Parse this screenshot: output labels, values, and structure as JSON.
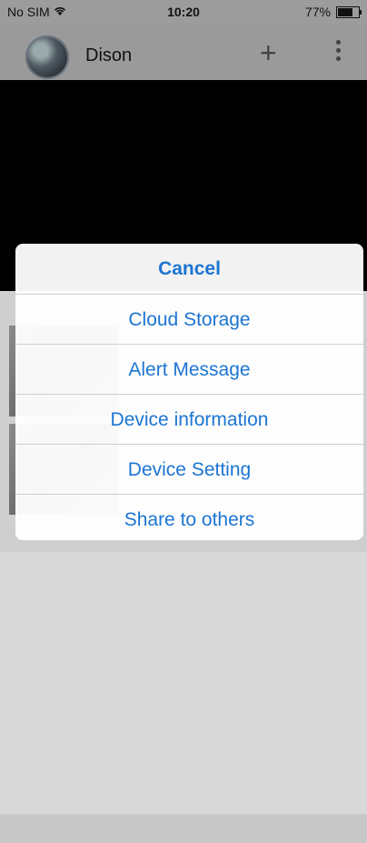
{
  "status_bar": {
    "carrier": "No SIM",
    "time": "10:20",
    "battery_percent": "77%"
  },
  "header": {
    "user_name": "Dison"
  },
  "action_sheet": {
    "items": [
      {
        "label": "Cancel"
      },
      {
        "label": "Cloud Storage"
      },
      {
        "label": "Alert Message"
      },
      {
        "label": "Device information"
      },
      {
        "label": "Device Setting"
      },
      {
        "label": "Share to others"
      }
    ]
  },
  "colors": {
    "accent": "#1c75d2"
  }
}
